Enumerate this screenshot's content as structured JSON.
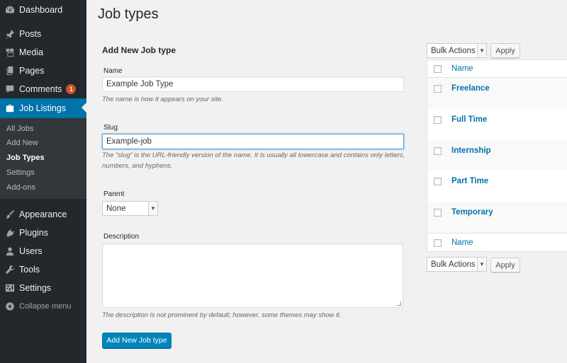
{
  "sidebar": {
    "items": [
      {
        "label": "Dashboard",
        "icon": "dashboard-icon"
      },
      {
        "label": "Posts",
        "icon": "pin-icon"
      },
      {
        "label": "Media",
        "icon": "media-icon"
      },
      {
        "label": "Pages",
        "icon": "pages-icon"
      },
      {
        "label": "Comments",
        "icon": "comment-icon",
        "badge": "1"
      },
      {
        "label": "Job Listings",
        "icon": "briefcase-icon"
      },
      {
        "label": "Appearance",
        "icon": "brush-icon"
      },
      {
        "label": "Plugins",
        "icon": "plugin-icon"
      },
      {
        "label": "Users",
        "icon": "user-icon"
      },
      {
        "label": "Tools",
        "icon": "wrench-icon"
      },
      {
        "label": "Settings",
        "icon": "settings-icon"
      }
    ],
    "submenu": [
      "All Jobs",
      "Add New",
      "Job Types",
      "Settings",
      "Add-ons"
    ],
    "collapse_label": "Collapse menu"
  },
  "page": {
    "title": "Job types"
  },
  "form": {
    "heading": "Add New Job type",
    "name_label": "Name",
    "name_value": "Example Job Type",
    "name_hint": "The name is how it appears on your site.",
    "slug_label": "Slug",
    "slug_value": "Example-job",
    "slug_hint_1": "The “slug” is the URL-friendly version of the name. It is usually all lowercase and contains only letters,",
    "slug_hint_2": "numbers, and hyphens.",
    "parent_label": "Parent",
    "parent_value": "None",
    "description_label": "Description",
    "description_hint": "The description is not prominent by default; however, some themes may show it.",
    "submit_label": "Add New Job type"
  },
  "table": {
    "bulk_actions": "Bulk Actions",
    "apply": "Apply",
    "column_name": "Name",
    "rows": [
      "Freelance",
      "Full Time",
      "Internship",
      "Part Time",
      "Temporary"
    ]
  },
  "colors": {
    "accent": "#0073aa",
    "sidebar": "#23282d",
    "badge": "#d54e21"
  }
}
